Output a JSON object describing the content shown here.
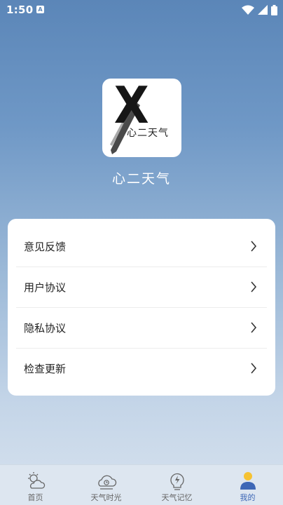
{
  "status_bar": {
    "time": "1:50",
    "notif_badge": "A"
  },
  "app": {
    "logo_letter": "X",
    "logo_text": "心二天气",
    "name": "心二天气"
  },
  "menu": {
    "items": [
      {
        "label": "意见反馈"
      },
      {
        "label": "用户协议"
      },
      {
        "label": "隐私协议"
      },
      {
        "label": "检查更新"
      }
    ]
  },
  "tabs": [
    {
      "label": "首页",
      "icon": "sun-cloud-icon"
    },
    {
      "label": "天气时光",
      "icon": "cloud-clock-icon"
    },
    {
      "label": "天气记忆",
      "icon": "lightning-bulb-icon"
    },
    {
      "label": "我的",
      "icon": "person-icon",
      "active": true
    }
  ],
  "colors": {
    "accent": "#3d67b6",
    "person_head": "#f5c233",
    "person_body": "#3d67b6"
  }
}
